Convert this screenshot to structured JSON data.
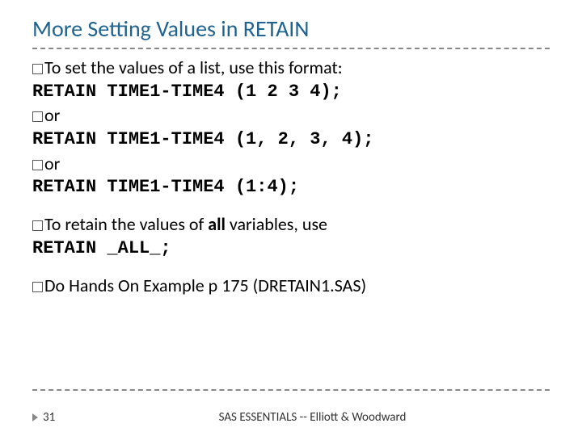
{
  "title": "More Setting Values in RETAIN",
  "lines": {
    "l1_a": "To set the values of a list, use this format:",
    "l2_code": "RETAIN TIME1-TIME4 (1 2 3 4);",
    "l3_or": "or",
    "l4_code": "RETAIN TIME1-TIME4 (1, 2, 3, 4);",
    "l5_or": "or",
    "l6_code": "RETAIN TIME1-TIME4 (1:4);",
    "l7_a": "To retain the values of ",
    "l7_b": "all",
    "l7_c": " variables, use",
    "l8_code": "RETAIN _ALL_;",
    "l9": "Do Hands On Example p 175 (DRETAIN1.SAS)"
  },
  "footer": {
    "page": "31",
    "text": "SAS ESSENTIALS -- Elliott & Woodward"
  }
}
